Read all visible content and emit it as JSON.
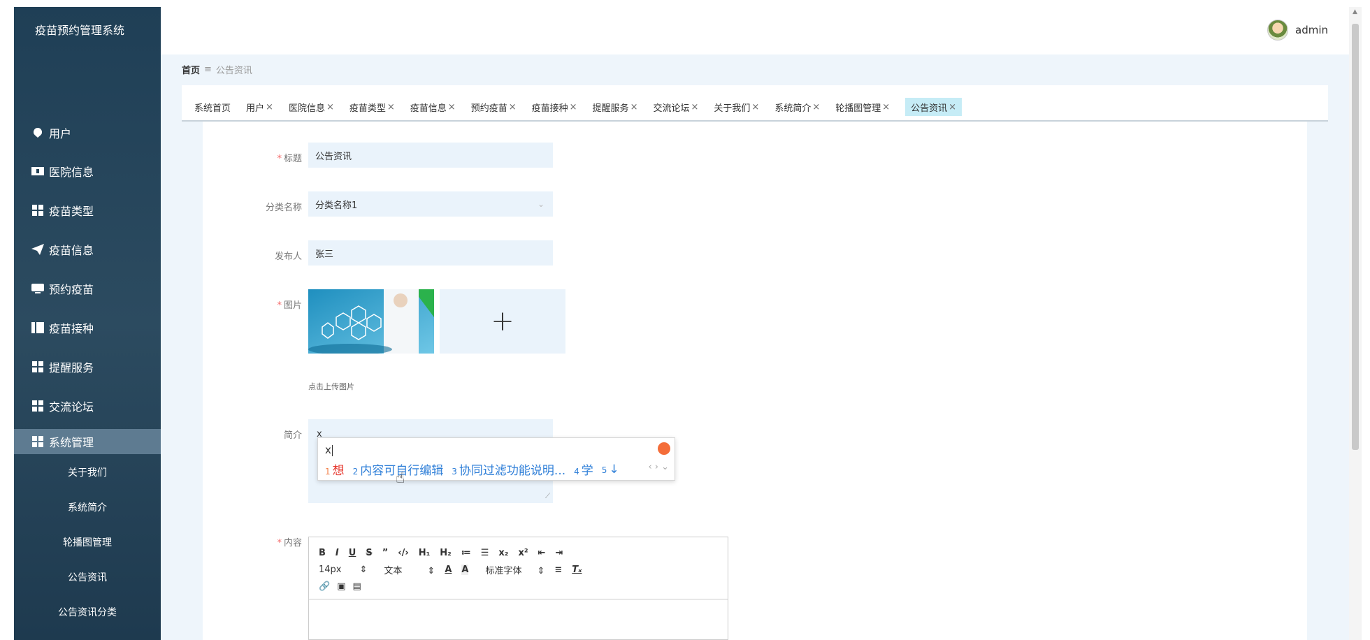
{
  "app": {
    "title": "疫苗预约管理系统"
  },
  "sidebar": {
    "items": [
      {
        "label": "用户",
        "icon": "chat-bubble-icon"
      },
      {
        "label": "医院信息",
        "icon": "ticket-icon"
      },
      {
        "label": "疫苗类型",
        "icon": "grid-icon"
      },
      {
        "label": "疫苗信息",
        "icon": "paper-plane-icon"
      },
      {
        "label": "预约疫苗",
        "icon": "monitor-icon"
      },
      {
        "label": "疫苗接种",
        "icon": "book-icon"
      },
      {
        "label": "提醒服务",
        "icon": "grid-icon"
      },
      {
        "label": "交流论坛",
        "icon": "grid-icon"
      },
      {
        "label": "系统管理",
        "icon": "grid-icon"
      }
    ],
    "subitems": [
      "关于我们",
      "系统简介",
      "轮播图管理",
      "公告资讯",
      "公告资讯分类"
    ]
  },
  "header": {
    "user": "admin"
  },
  "breadcrumb": {
    "home": "首页",
    "separator": "≡",
    "current": "公告资讯"
  },
  "tabs": [
    {
      "label": "系统首页",
      "close": ""
    },
    {
      "label": "用户",
      "close": "×"
    },
    {
      "label": "医院信息",
      "close": "×"
    },
    {
      "label": "疫苗类型",
      "close": "×"
    },
    {
      "label": "疫苗信息",
      "close": "×"
    },
    {
      "label": "预约疫苗",
      "close": "×"
    },
    {
      "label": "疫苗接种",
      "close": "×"
    },
    {
      "label": "提醒服务",
      "close": "×"
    },
    {
      "label": "交流论坛",
      "close": "×"
    },
    {
      "label": "关于我们",
      "close": "×"
    },
    {
      "label": "系统简介",
      "close": "×"
    },
    {
      "label": "轮播图管理",
      "close": "×"
    },
    {
      "label": "公告资讯",
      "close": "×"
    }
  ],
  "form": {
    "title_label": "标题",
    "title_value": "公告资讯",
    "category_label": "分类名称",
    "category_value": "分类名称1",
    "publisher_label": "发布人",
    "publisher_value": "张三",
    "image_label": "图片",
    "upload_plus": "+",
    "upload_hint": "点击上传图片",
    "intro_label": "简介",
    "intro_value": "x",
    "content_label": "内容",
    "required_mark": "*"
  },
  "ime": {
    "input": "x",
    "candidates": [
      {
        "num": "1",
        "text": "想"
      },
      {
        "num": "2",
        "text": "内容可自行编辑"
      },
      {
        "num": "3",
        "text": "协同过滤功能说明..."
      },
      {
        "num": "4",
        "text": "学"
      },
      {
        "num": "5",
        "text": "↓"
      }
    ],
    "nav": "‹ › ⌄"
  },
  "editor": {
    "row1": [
      "B",
      "I",
      "U",
      "S",
      "”",
      "‹/›",
      "H₁",
      "H₂",
      "≔",
      "☰",
      "x₂",
      "x²",
      "⇤",
      "⇥"
    ],
    "size": "14px",
    "size_arrow": "⇕",
    "text_type": "文本",
    "text_arrow": "⇕",
    "font_family": "标准字体",
    "font_arrow": "⇕",
    "row2_icons": [
      "A",
      "A",
      "≡",
      "Tₓ"
    ],
    "row3_icons": [
      "🔗",
      "▣",
      "▤"
    ]
  }
}
